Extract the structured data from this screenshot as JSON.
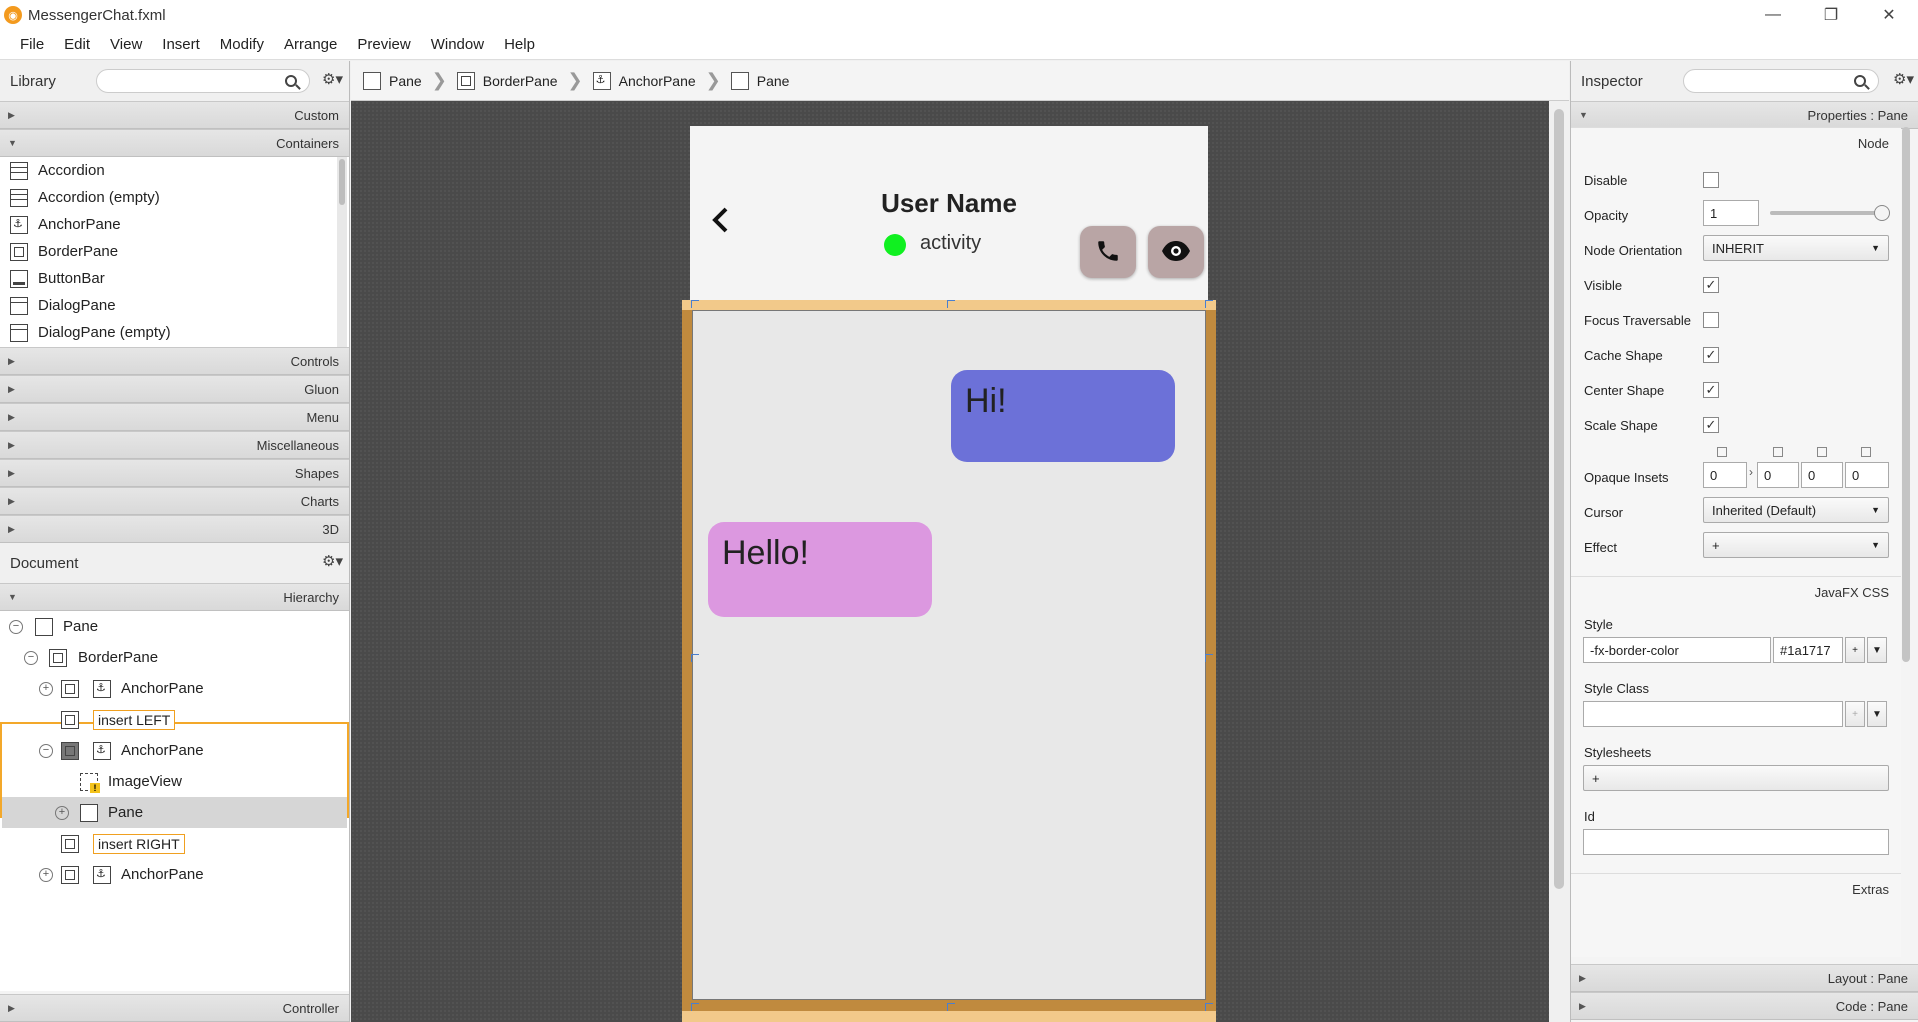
{
  "window": {
    "title": "MessengerChat.fxml",
    "minimize": "—",
    "restore": "❐",
    "close": "✕"
  },
  "menu": [
    "File",
    "Edit",
    "View",
    "Insert",
    "Modify",
    "Arrange",
    "Preview",
    "Window",
    "Help"
  ],
  "library": {
    "title": "Library",
    "sections_top": [
      "Custom",
      "Containers"
    ],
    "items": [
      "Accordion",
      "Accordion  (empty)",
      "AnchorPane",
      "BorderPane",
      "ButtonBar",
      "DialogPane",
      "DialogPane  (empty)"
    ],
    "sections_bottom": [
      "Controls",
      "Gluon",
      "Menu",
      "Miscellaneous",
      "Shapes",
      "Charts",
      "3D"
    ]
  },
  "document": {
    "title": "Document",
    "hierarchy_label": "Hierarchy",
    "controller_label": "Controller",
    "tree": [
      "Pane",
      "BorderPane",
      "AnchorPane",
      "insert LEFT",
      "AnchorPane",
      "ImageView",
      "Pane",
      "insert RIGHT",
      "AnchorPane"
    ]
  },
  "breadcrumb": [
    "Pane",
    "BorderPane",
    "AnchorPane",
    "Pane"
  ],
  "canvas": {
    "user_name": "User Name",
    "activity": "activity",
    "back_icon": "‹",
    "bubble_out": "Hi!",
    "bubble_in": "Hello!",
    "colors": {
      "bubble_out": "#6c71d8",
      "bubble_in": "#dc98e0",
      "status_dot": "#10f020",
      "header_button": "#b9a5a5"
    }
  },
  "inspector": {
    "title": "Inspector",
    "properties_header": "Properties : Pane",
    "node_section": "Node",
    "props": {
      "disable": "Disable",
      "opacity": "Opacity",
      "opacity_value": "1",
      "node_orientation": "Node Orientation",
      "node_orientation_value": "INHERIT",
      "visible": "Visible",
      "focus_traversable": "Focus Traversable",
      "cache_shape": "Cache Shape",
      "center_shape": "Center Shape",
      "scale_shape": "Scale Shape",
      "opaque_insets": "Opaque Insets",
      "insets": [
        "0",
        "0",
        "0",
        "0"
      ],
      "cursor": "Cursor",
      "cursor_value": "Inherited (Default)",
      "effect": "Effect",
      "effect_value": "+"
    },
    "css_section": "JavaFX CSS",
    "style_label": "Style",
    "style_property": "-fx-border-color",
    "style_value": "#1a1717",
    "style_class_label": "Style Class",
    "stylesheets_label": "Stylesheets",
    "stylesheets_add": "+",
    "id_label": "Id",
    "extras_section": "Extras",
    "layout_header": "Layout : Pane",
    "code_header": "Code : Pane"
  }
}
